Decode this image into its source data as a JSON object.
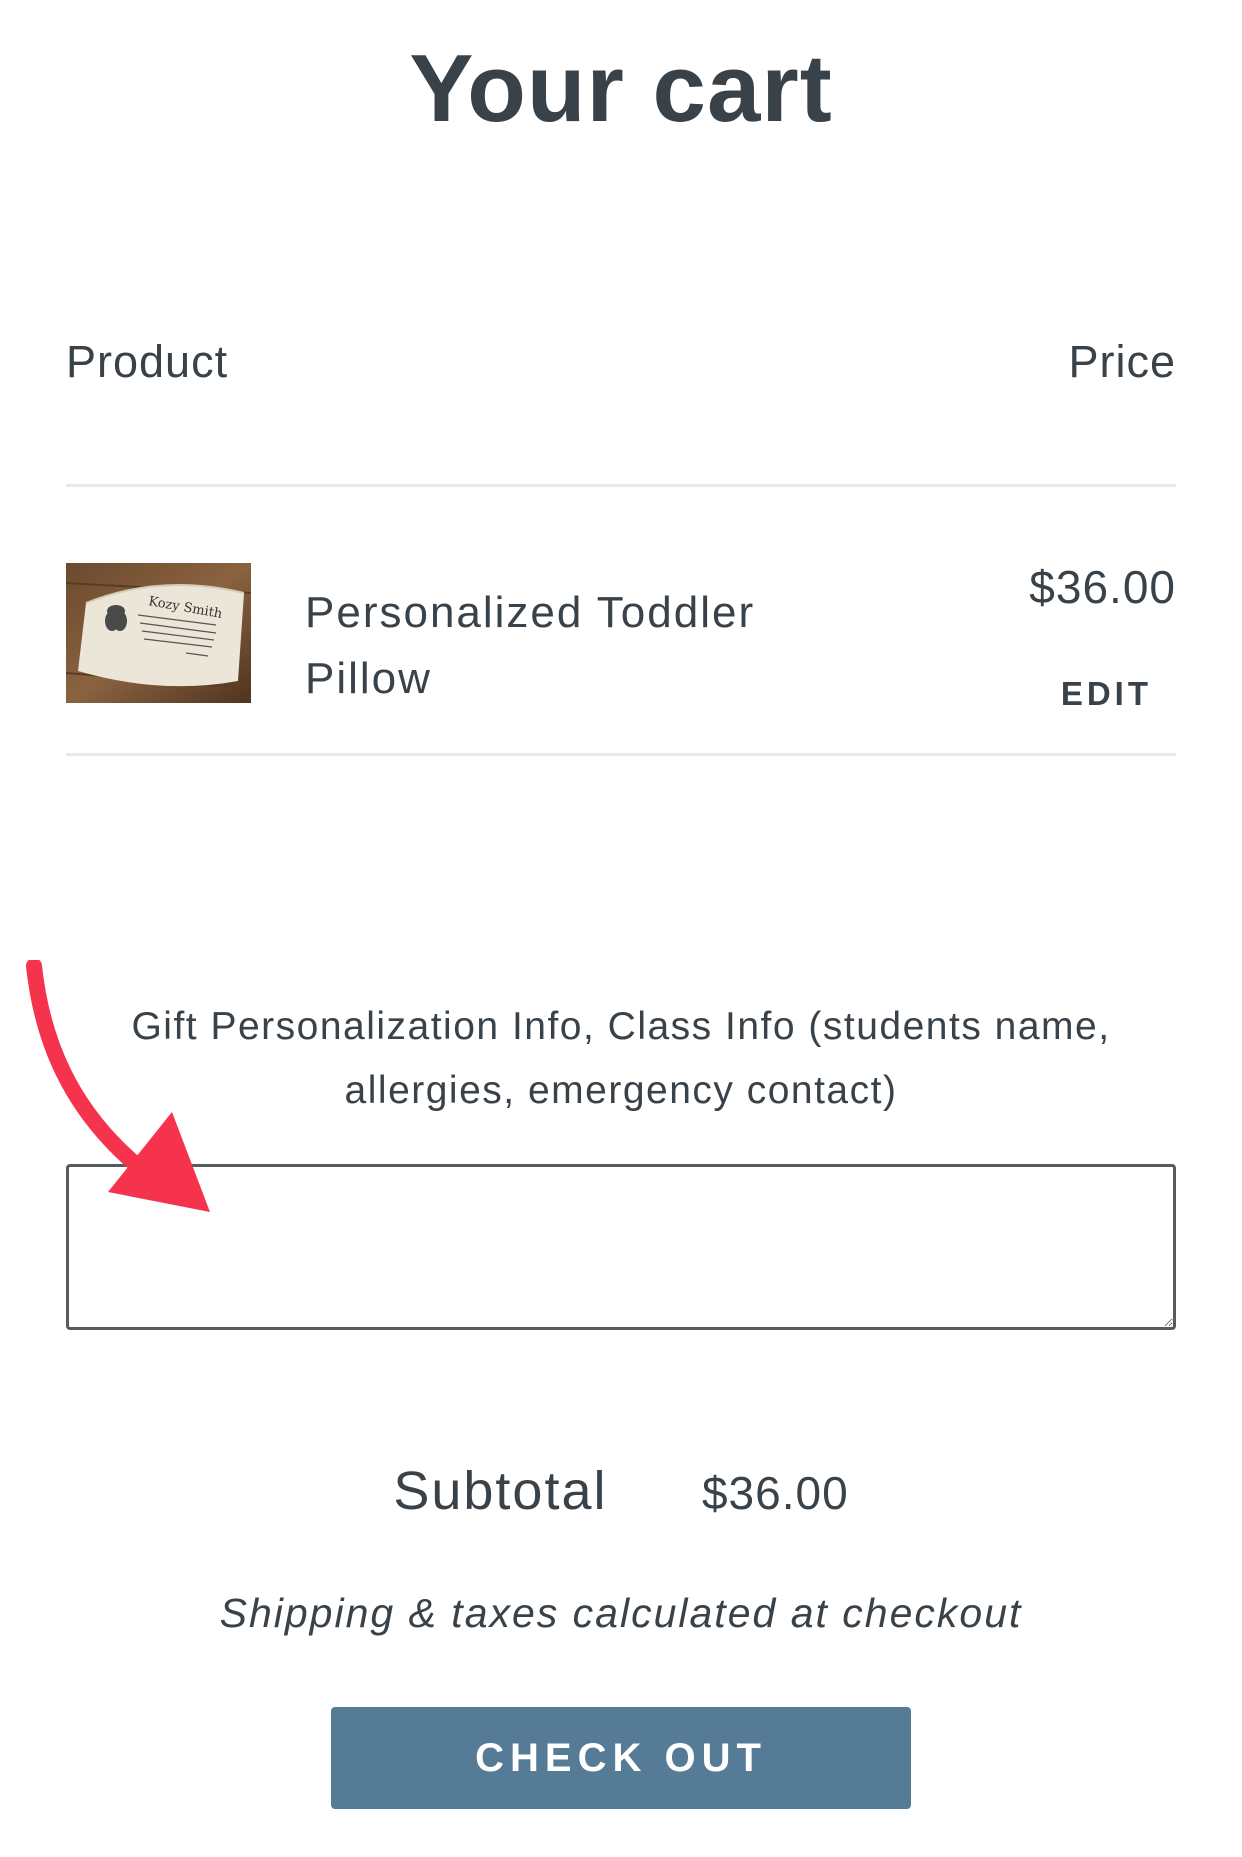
{
  "page": {
    "title": "Your cart"
  },
  "table": {
    "product_header": "Product",
    "price_header": "Price"
  },
  "line_item": {
    "image_label": "product-thumbnail",
    "image_text_line1": "Kozy Smith",
    "name": "Personalized Toddler Pillow",
    "price": "$36.00",
    "edit_label": "EDIT"
  },
  "note": {
    "label": "Gift Personalization Info, Class Info (students name, allergies, emergency contact)",
    "value": "",
    "placeholder": ""
  },
  "summary": {
    "subtotal_label": "Subtotal",
    "subtotal_value": "$36.00",
    "shipping_note": "Shipping & taxes calculated at checkout"
  },
  "checkout": {
    "label": "CHECK OUT"
  },
  "colors": {
    "text": "#3a4249",
    "button": "#557b97",
    "button_text": "#ffffff",
    "divider": "#e8e9eb",
    "annotation_arrow": "#f5334d"
  },
  "icons": {
    "annotation": "red-arrow-icon"
  }
}
